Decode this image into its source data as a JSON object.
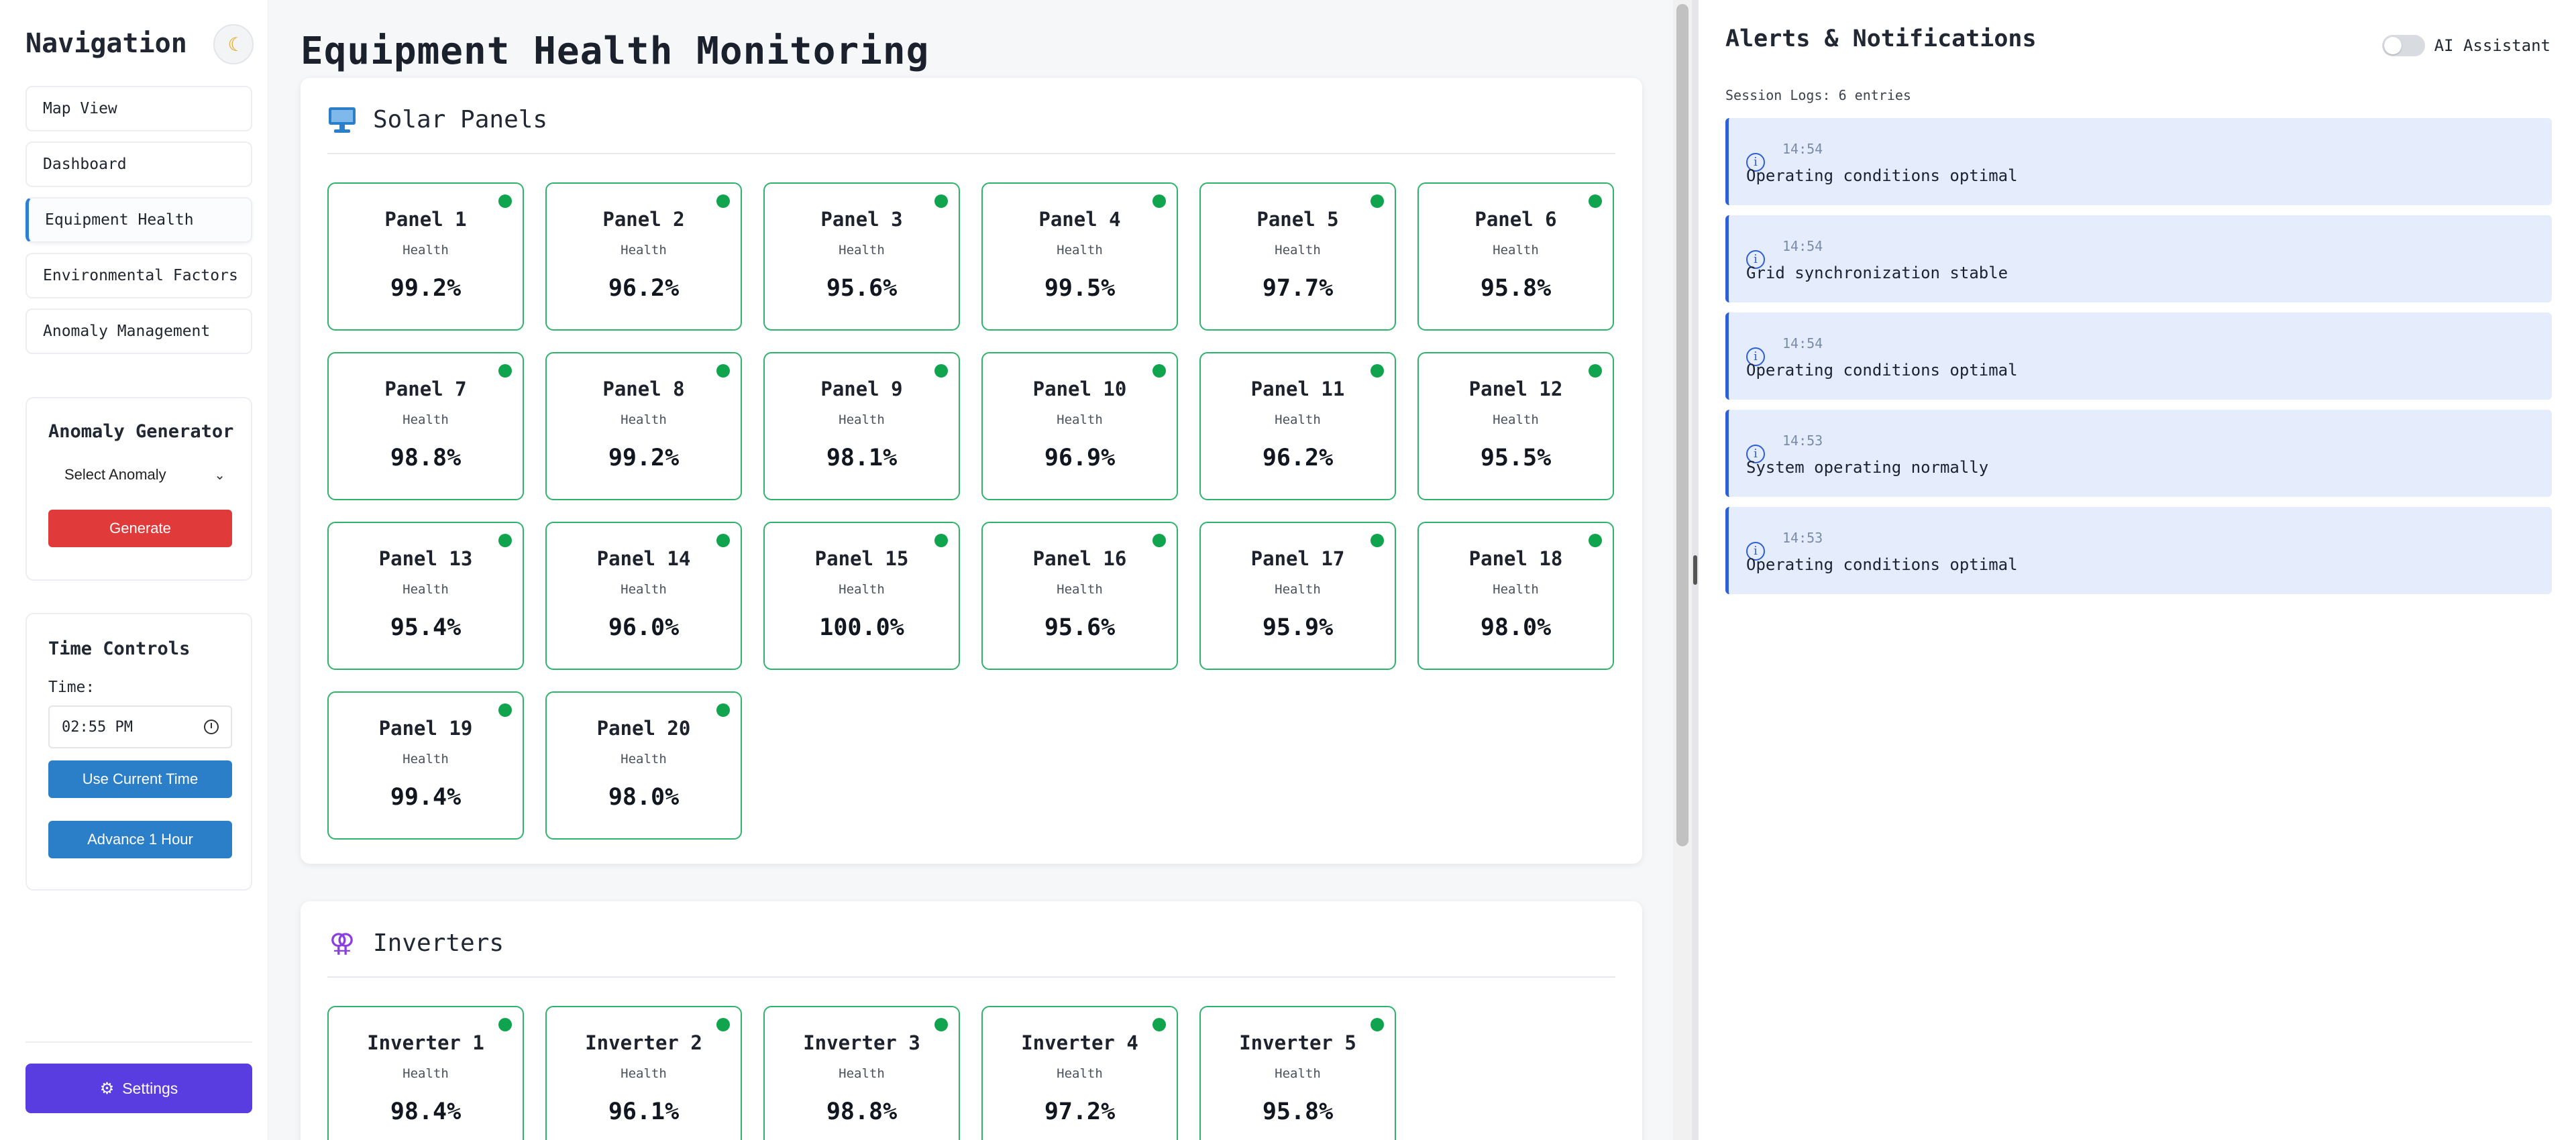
{
  "sidebar": {
    "title": "Navigation",
    "theme_icon": "moon-icon",
    "nav_items": [
      {
        "label": "Map View"
      },
      {
        "label": "Dashboard"
      },
      {
        "label": "Equipment Health"
      },
      {
        "label": "Environmental Factors"
      },
      {
        "label": "Anomaly Management"
      }
    ],
    "active_item": "Equipment Health",
    "anomaly": {
      "title": "Anomaly Generator",
      "select_value": "Select Anomaly",
      "generate_label": "Generate"
    },
    "time": {
      "title": "Time Controls",
      "label": "Time:",
      "value": "02:55 PM",
      "use_current_label": "Use Current Time",
      "advance_label": "Advance 1 Hour"
    },
    "settings_label": "Settings"
  },
  "main": {
    "title": "Equipment Health Monitoring",
    "solar": {
      "title": "Solar Panels",
      "health_label": "Health",
      "items": [
        {
          "name": "Panel 1",
          "value": "99.2%"
        },
        {
          "name": "Panel 2",
          "value": "96.2%"
        },
        {
          "name": "Panel 3",
          "value": "95.6%"
        },
        {
          "name": "Panel 4",
          "value": "99.5%"
        },
        {
          "name": "Panel 5",
          "value": "97.7%"
        },
        {
          "name": "Panel 6",
          "value": "95.8%"
        },
        {
          "name": "Panel 7",
          "value": "98.8%"
        },
        {
          "name": "Panel 8",
          "value": "99.2%"
        },
        {
          "name": "Panel 9",
          "value": "98.1%"
        },
        {
          "name": "Panel 10",
          "value": "96.9%"
        },
        {
          "name": "Panel 11",
          "value": "96.2%"
        },
        {
          "name": "Panel 12",
          "value": "95.5%"
        },
        {
          "name": "Panel 13",
          "value": "95.4%"
        },
        {
          "name": "Panel 14",
          "value": "96.0%"
        },
        {
          "name": "Panel 15",
          "value": "100.0%"
        },
        {
          "name": "Panel 16",
          "value": "95.6%"
        },
        {
          "name": "Panel 17",
          "value": "95.9%"
        },
        {
          "name": "Panel 18",
          "value": "98.0%"
        },
        {
          "name": "Panel 19",
          "value": "99.4%"
        },
        {
          "name": "Panel 20",
          "value": "98.0%"
        }
      ]
    },
    "inverters": {
      "title": "Inverters",
      "health_label": "Health",
      "items": [
        {
          "name": "Inverter 1",
          "value": "98.4%"
        },
        {
          "name": "Inverter 2",
          "value": "96.1%"
        },
        {
          "name": "Inverter 3",
          "value": "98.8%"
        },
        {
          "name": "Inverter 4",
          "value": "97.2%"
        },
        {
          "name": "Inverter 5",
          "value": "95.8%"
        }
      ]
    },
    "status_color": "#11a44f"
  },
  "alerts": {
    "title": "Alerts & Notifications",
    "ai_label": "AI Assistant",
    "ai_enabled": false,
    "session_text": "Session Logs: 6 entries",
    "logs": [
      {
        "time": "14:54",
        "message": "Operating conditions optimal"
      },
      {
        "time": "14:54",
        "message": "Grid synchronization stable"
      },
      {
        "time": "14:54",
        "message": "Operating conditions optimal"
      },
      {
        "time": "14:53",
        "message": "System operating normally"
      },
      {
        "time": "14:53",
        "message": "Operating conditions optimal"
      }
    ]
  }
}
